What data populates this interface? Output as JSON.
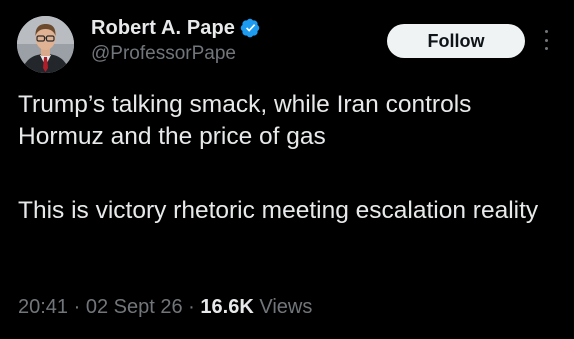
{
  "author": {
    "display_name": "Robert A. Pape",
    "handle": "@ProfessorPape",
    "verified": true,
    "verified_color": "#1d9bf0"
  },
  "actions": {
    "follow_label": "Follow",
    "more_icon": "more-vertical-icon"
  },
  "tweet": {
    "paragraphs": [
      "Trump’s talking smack, while Iran controls Hormuz and the price of gas",
      "This is victory rhetoric meeting escalation reality"
    ]
  },
  "meta": {
    "time": "20:41",
    "separator": "·",
    "date": "02 Sept 26",
    "views_count": "16.6K",
    "views_label": "Views"
  },
  "colors": {
    "background": "#000000",
    "text_primary": "#e7e9ea",
    "text_secondary": "#71767b",
    "button_bg": "#eff3f4",
    "button_text": "#0f1419"
  }
}
